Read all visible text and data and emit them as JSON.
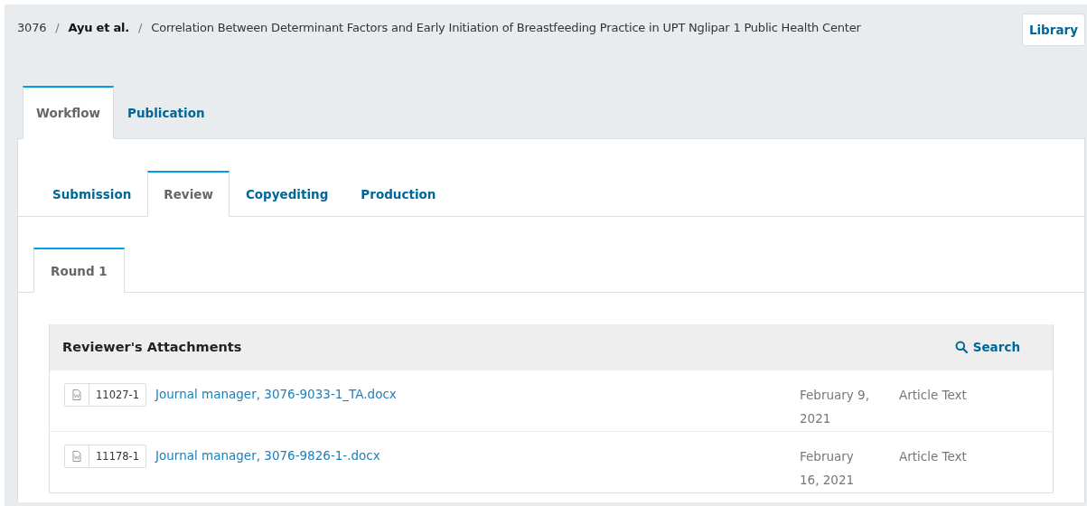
{
  "breadcrumb": {
    "id": "3076",
    "authors": "Ayu et al.",
    "separators": [
      "/",
      "/"
    ],
    "title": "Correlation Between Determinant Factors and Early Initiation of Breastfeeding Practice in UPT Nglipar 1 Public Health Center"
  },
  "library_button": "Library",
  "main_tabs": [
    {
      "label": "Workflow",
      "selected": true
    },
    {
      "label": "Publication",
      "selected": false
    }
  ],
  "stage_tabs": [
    {
      "label": "Submission",
      "selected": false
    },
    {
      "label": "Review",
      "selected": true
    },
    {
      "label": "Copyediting",
      "selected": false
    },
    {
      "label": "Production",
      "selected": false
    }
  ],
  "round_tabs": [
    {
      "label": "Round 1",
      "selected": true
    }
  ],
  "grid": {
    "title": "Reviewer's Attachments",
    "search": "Search",
    "rows": [
      {
        "file_id": "11027-1",
        "name": "Journal manager, 3076-9033-1_TA.docx",
        "date": "February 9, 2021",
        "type": "Article Text"
      },
      {
        "file_id": "11178-1",
        "name": "Journal manager, 3076-9826-1-.docx",
        "date": "February 16, 2021",
        "type": "Article Text"
      }
    ]
  }
}
